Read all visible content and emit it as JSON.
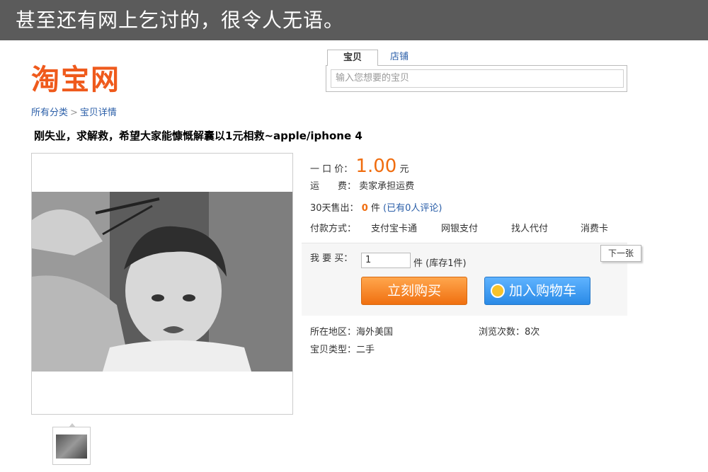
{
  "banner": {
    "text": "甚至还有网上乞讨的，很令人无语。"
  },
  "logo": {
    "text": "淘宝网"
  },
  "search": {
    "tabs": [
      "宝贝",
      "店铺"
    ],
    "placeholder": "输入您想要的宝贝"
  },
  "breadcrumb": {
    "items": [
      "所有分类",
      "宝贝详情"
    ],
    "separator": ">"
  },
  "item": {
    "title": "刚失业，求解救，希望大家能慷慨解囊以1元相救~apple/iphone 4",
    "price_label": "一 口 价：",
    "price": "1.00",
    "price_unit": "元",
    "shipping_label": "运　　费：",
    "shipping": "卖家承担运费",
    "sold_label": "30天售出：",
    "sold_count": "0",
    "sold_unit": "件",
    "reviews": "(已有0人评论)",
    "payment_label": "付款方式：",
    "payment_methods": [
      "支付宝卡通",
      "网银支付",
      "找人代付",
      "消费卡"
    ],
    "buy_label": "我 要 买：",
    "quantity": "1",
    "quantity_unit": "件",
    "stock": "(库存1件)",
    "buy_now": "立刻购买",
    "add_cart": "加入购物车",
    "next": "下一张",
    "location_label": "所在地区：",
    "location": "海外美国",
    "views_label": "浏览次数：",
    "views": "8次",
    "type_label": "宝贝类型：",
    "type": "二手"
  },
  "colors": {
    "price": "#f06d0f",
    "link": "#2a5ea8",
    "logo": "#ef5a1c",
    "banner": "#5b5b5b"
  }
}
